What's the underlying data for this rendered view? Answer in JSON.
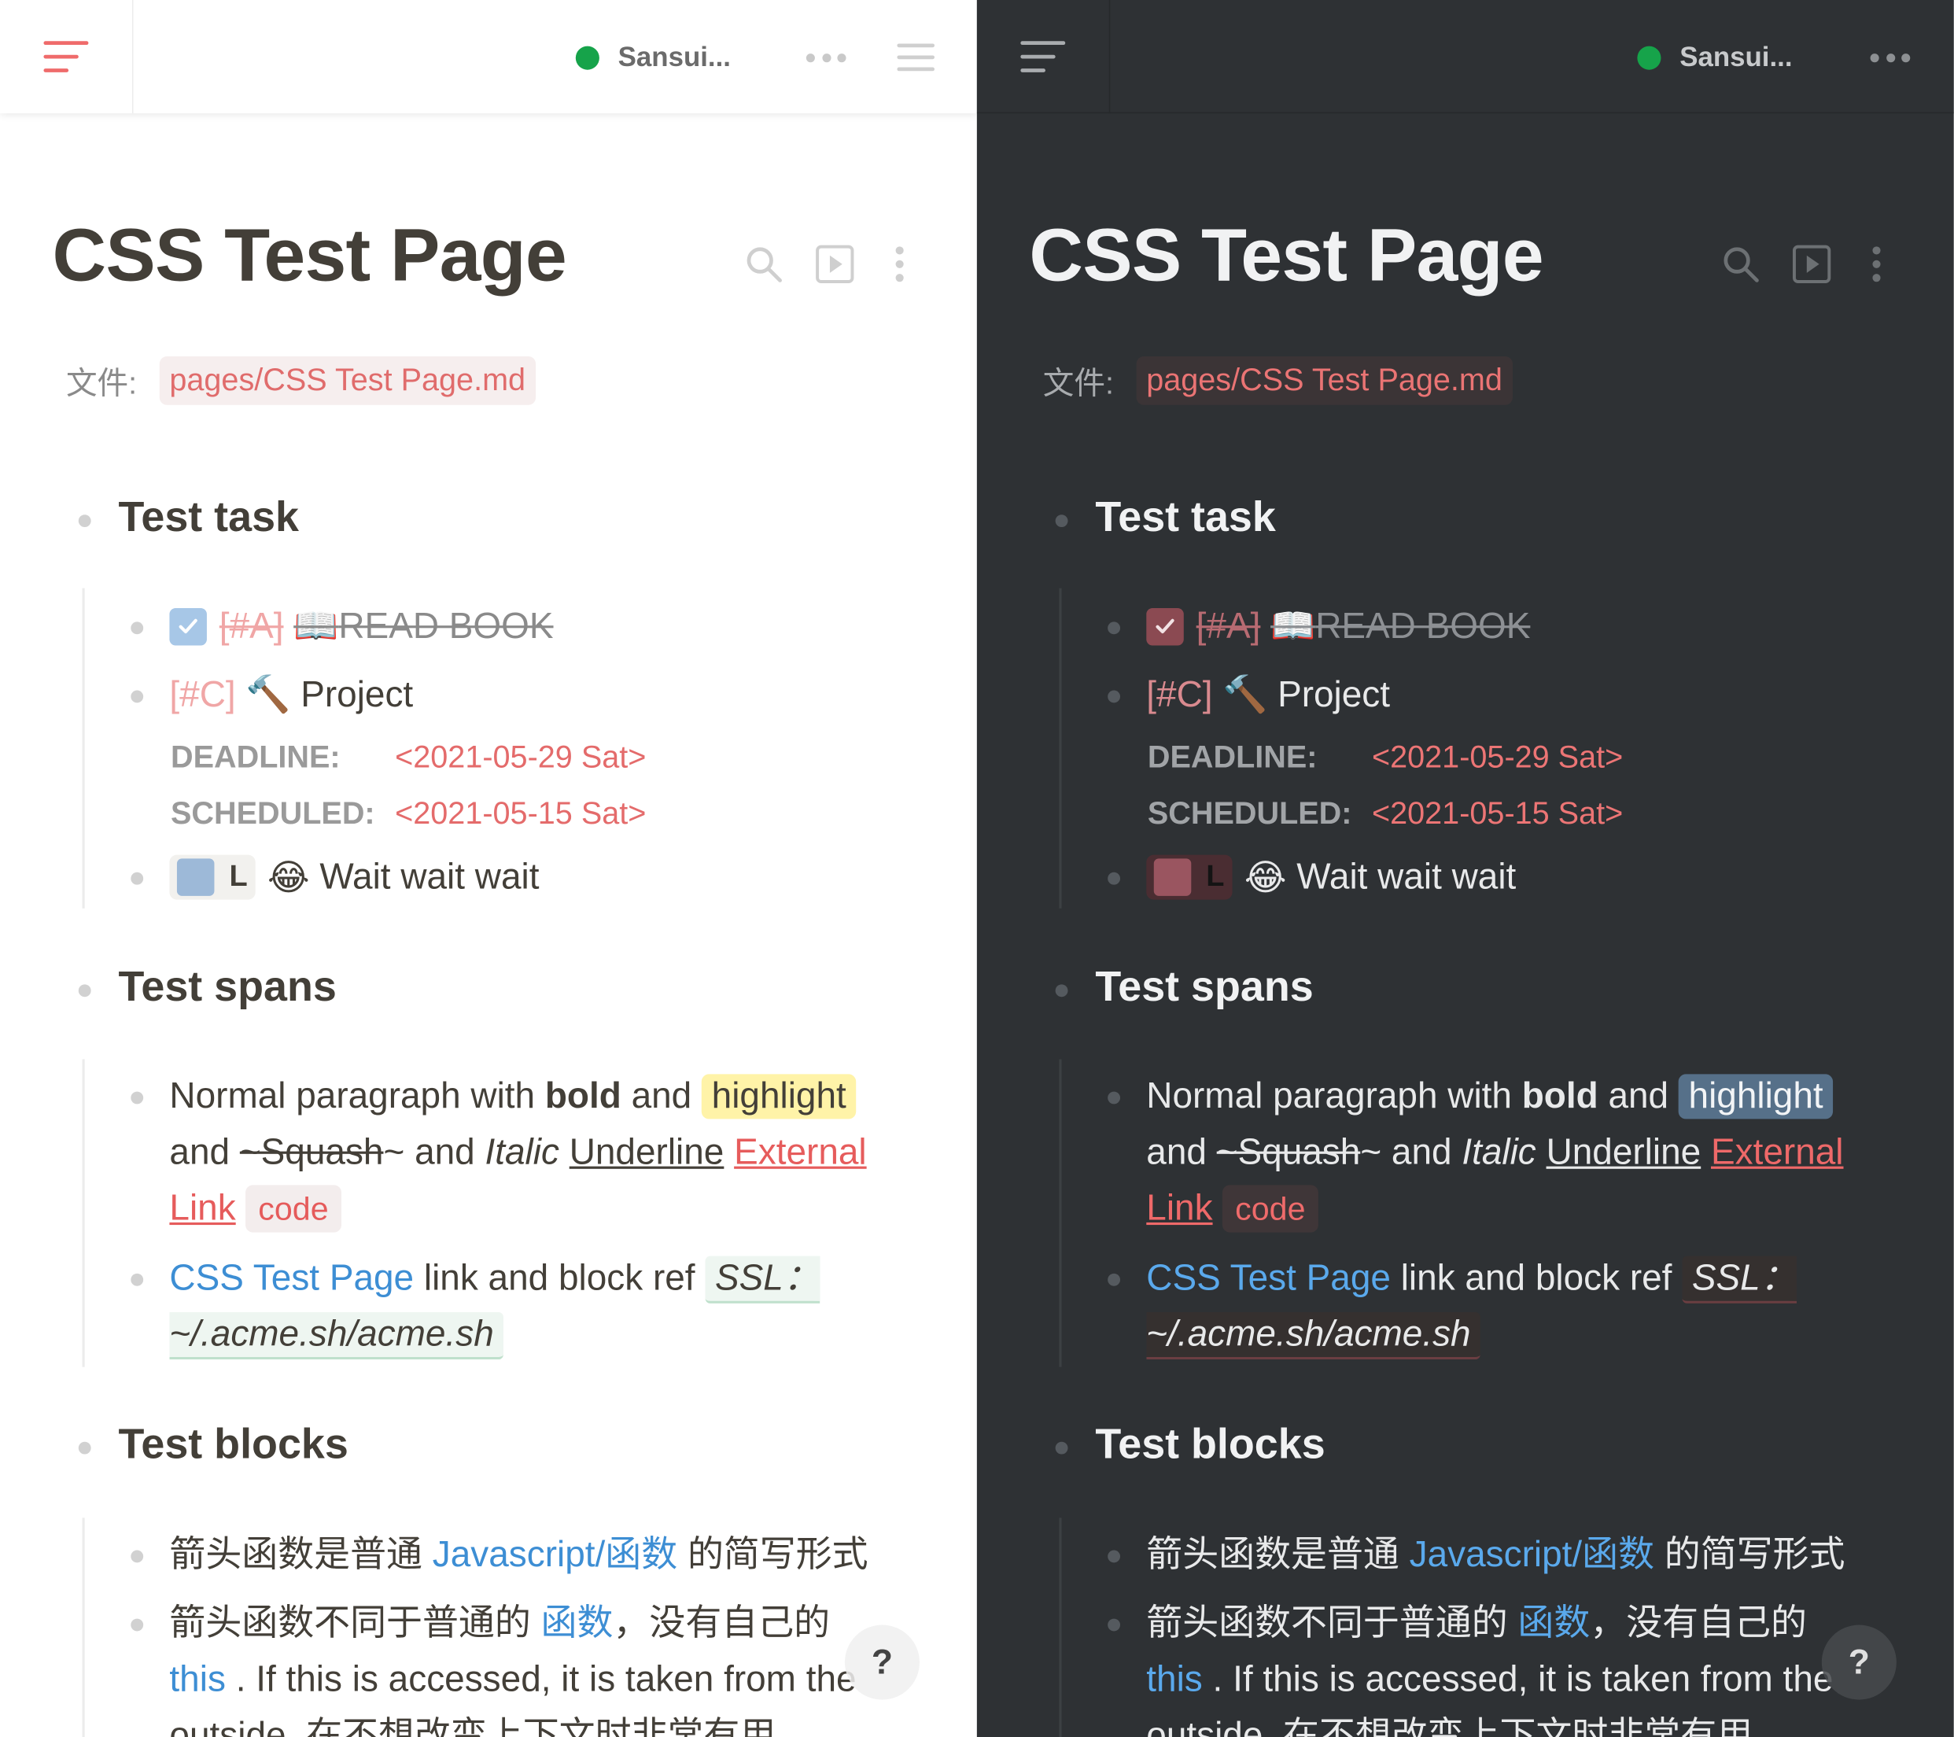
{
  "panes": {
    "light": {
      "theme": "light",
      "sync_name": "Sansui...",
      "page_title": "CSS Test Page",
      "property_label": "文件:",
      "property_value": "pages/CSS Test Page.md",
      "sections": {
        "task_heading": "Test task",
        "spans_heading": "Test spans",
        "blocks_heading": "Test blocks"
      },
      "tasks": {
        "done_priority": "[#A]",
        "done_emoji": "📖",
        "done_text": "READ BOOK",
        "project_priority": "[#C]",
        "project_emoji": "🔨",
        "project_text": "Project",
        "deadline_label": "DEADLINE:",
        "deadline_value": "<2021-05-29 Sat>",
        "scheduled_label": "SCHEDULED:",
        "scheduled_value": "<2021-05-15 Sat>",
        "wait_marker": "L",
        "wait_emoji": "😂",
        "wait_text": "Wait wait wait"
      },
      "spans": {
        "p1_a": "Normal paragraph with ",
        "p1_bold": "bold",
        "p1_b": " and ",
        "p1_highlight": "highlight",
        "p1_c": "and ",
        "p1_strike": "~Squash",
        "p1_d": "~ and ",
        "p1_italic": "Italic",
        "p1_e": " ",
        "p1_underline": "Underline",
        "p1_f": " ",
        "p1_link": "External Link",
        "p1_g": " ",
        "p1_code": "code",
        "p2_page_link": "CSS Test Page",
        "p2_a": " link and block ref ",
        "p2_block_ref": "SSL： ~/.acme.sh/acme.sh"
      },
      "blocks": {
        "b1_a": "箭头函数是普通 ",
        "b1_link": "Javascript/函数",
        "b1_b": " 的简写形式",
        "b2_a": "箭头函数不同于普通的 ",
        "b2_link": "函数",
        "b2_b": "，没有自己的",
        "b2_this": "this",
        "b2_c": " . If this is accessed, it is taken from the",
        "b2_d": "outside. 在不想改变上下文时非常有用。"
      },
      "help_label": "?"
    },
    "dark": {
      "theme": "dark",
      "sync_name": "Sansui...",
      "page_title": "CSS Test Page",
      "property_label": "文件:",
      "property_value": "pages/CSS Test Page.md",
      "sections": {
        "task_heading": "Test task",
        "spans_heading": "Test spans",
        "blocks_heading": "Test blocks"
      },
      "tasks": {
        "done_priority": "[#A]",
        "done_emoji": "📖",
        "done_text": "READ BOOK",
        "project_priority": "[#C]",
        "project_emoji": "🔨",
        "project_text": "Project",
        "deadline_label": "DEADLINE:",
        "deadline_value": "<2021-05-29 Sat>",
        "scheduled_label": "SCHEDULED:",
        "scheduled_value": "<2021-05-15 Sat>",
        "wait_marker": "L",
        "wait_emoji": "😂",
        "wait_text": "Wait wait wait"
      },
      "spans": {
        "p1_a": "Normal paragraph with ",
        "p1_bold": "bold",
        "p1_b": " and ",
        "p1_highlight": "highlight",
        "p1_c": "and ",
        "p1_strike": "~Squash",
        "p1_d": "~ and ",
        "p1_italic": "Italic",
        "p1_e": " ",
        "p1_underline": "Underline",
        "p1_f": " ",
        "p1_link": "External Link",
        "p1_g": " ",
        "p1_code": "code",
        "p2_page_link": "CSS Test Page",
        "p2_a": " link and block ref ",
        "p2_block_ref": "SSL： ~/.acme.sh/acme.sh"
      },
      "blocks": {
        "b1_a": "箭头函数是普通 ",
        "b1_link": "Javascript/函数",
        "b1_b": " 的简写形式",
        "b2_a": "箭头函数不同于普通的 ",
        "b2_link": "函数",
        "b2_b": "，没有自己的",
        "b2_this": "this",
        "b2_c": " . If this is accessed, it is taken from the",
        "b2_d": "outside. 在不想改变上下文时非常有用。"
      },
      "help_label": "?"
    }
  },
  "icons": {
    "sidebar_toggle": "left-sidebar-icon",
    "sync_status": "sync-status-dot",
    "more": "more-horizontal-icon",
    "right_menu": "right-sidebar-icon",
    "search": "search-icon",
    "slides": "presentation-icon",
    "page_menu": "more-vertical-icon",
    "checkmark": "check-icon"
  },
  "colors": {
    "light_bg": "#ffffff",
    "dark_bg": "#2e3134",
    "accent_red": "#e65c5c",
    "sync_green": "#16a34a",
    "page_link_blue": "#3d8ed4",
    "light_highlight": "#fff3a8",
    "dark_highlight": "#567089"
  }
}
